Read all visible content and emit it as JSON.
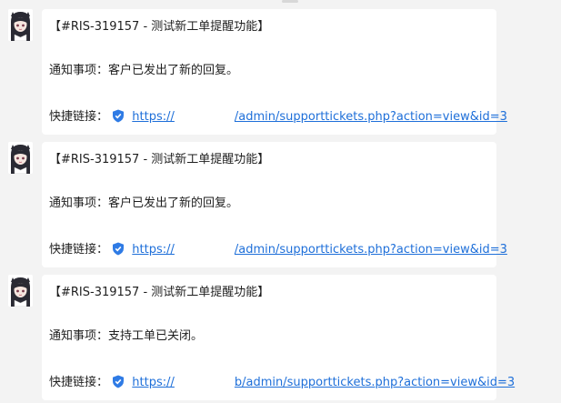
{
  "messages": [
    {
      "title": "【#RIS-319157 - 测试新工单提醒功能】",
      "notice": "通知事项：客户已发出了新的回复。",
      "link_label": "快捷链接：",
      "link_prefix": "https://",
      "link_suffix": "/admin/supporttickets.php?action=view&id=3"
    },
    {
      "title": "【#RIS-319157 - 测试新工单提醒功能】",
      "notice": "通知事项：客户已发出了新的回复。",
      "link_label": "快捷链接：",
      "link_prefix": "https://",
      "link_suffix": "/admin/supporttickets.php?action=view&id=3"
    },
    {
      "title": "【#RIS-319157 - 测试新工单提醒功能】",
      "notice": "通知事项：支持工单已关闭。",
      "link_label": "快捷链接：",
      "link_prefix": "https://",
      "link_suffix": "b/admin/supporttickets.php?action=view&id=3"
    }
  ],
  "colors": {
    "link": "#1e6fd9",
    "shield": "#2f7be5",
    "bubble": "#ffffff",
    "background": "#f3f3f3"
  },
  "icons": {
    "avatar": "anime-avatar",
    "link_badge": "shield-check-icon"
  }
}
